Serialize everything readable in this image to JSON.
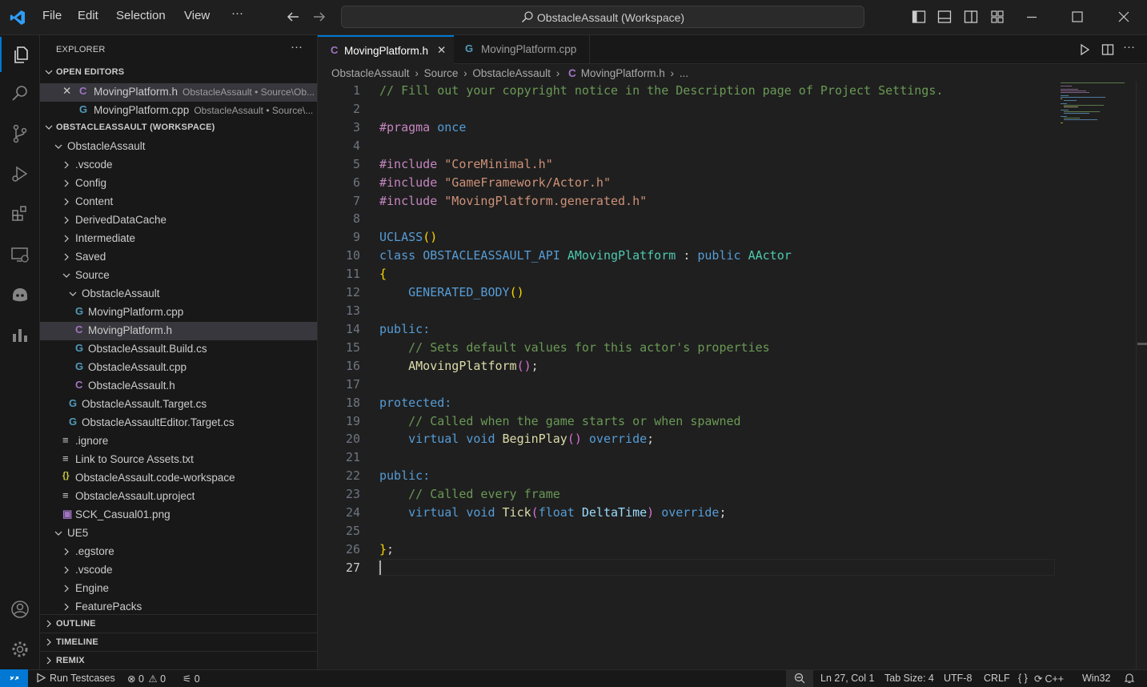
{
  "titlebar": {
    "menu": [
      "File",
      "Edit",
      "Selection",
      "View"
    ],
    "more": "···",
    "command_center": "ObstacleAssault (Workspace)"
  },
  "sidebar": {
    "title": "EXPLORER",
    "more": "···",
    "open_editors": {
      "header": "OPEN EDITORS",
      "items": [
        {
          "name": "MovingPlatform.h",
          "desc": "ObstacleAssault • Source\\Ob..."
        },
        {
          "name": "MovingPlatform.cpp",
          "desc": "ObstacleAssault • Source\\..."
        }
      ]
    },
    "workspace_header": "OBSTACLEASSAULT (WORKSPACE)",
    "tree": [
      "ObstacleAssault",
      ".vscode",
      "Config",
      "Content",
      "DerivedDataCache",
      "Intermediate",
      "Saved",
      "Source",
      "ObstacleAssault",
      "MovingPlatform.cpp",
      "MovingPlatform.h",
      "ObstacleAssault.Build.cs",
      "ObstacleAssault.cpp",
      "ObstacleAssault.h",
      "ObstacleAssault.Target.cs",
      "ObstacleAssaultEditor.Target.cs",
      ".ignore",
      "Link to Source Assets.txt",
      "ObstacleAssault.code-workspace",
      "ObstacleAssault.uproject",
      "SCK_Casual01.png",
      "UE5",
      ".egstore",
      ".vscode",
      "Engine",
      "FeaturePacks"
    ],
    "outline": "OUTLINE",
    "timeline": "TIMELINE",
    "remix": "REMIX"
  },
  "editor": {
    "tabs": [
      "MovingPlatform.h",
      "MovingPlatform.cpp"
    ],
    "breadcrumb": [
      "ObstacleAssault",
      "Source",
      "ObstacleAssault",
      "MovingPlatform.h",
      "..."
    ],
    "line_numbers": [
      "1",
      "2",
      "3",
      "4",
      "5",
      "6",
      "7",
      "8",
      "9",
      "10",
      "11",
      "12",
      "13",
      "14",
      "15",
      "16",
      "17",
      "18",
      "19",
      "20",
      "21",
      "22",
      "23",
      "24",
      "25",
      "26",
      "27"
    ],
    "code": [
      "// Fill out your copyright notice in the Description page of Project Settings.",
      "",
      "#pragma once",
      "",
      "#include \"CoreMinimal.h\"",
      "#include \"GameFramework/Actor.h\"",
      "#include \"MovingPlatform.generated.h\"",
      "",
      "UCLASS()",
      "class OBSTACLEASSAULT_API AMovingPlatform : public AActor",
      "{",
      "    GENERATED_BODY()",
      "",
      "public:",
      "    // Sets default values for this actor's properties",
      "    AMovingPlatform();",
      "",
      "protected:",
      "    // Called when the game starts or when spawned",
      "    virtual void BeginPlay() override;",
      "",
      "public:",
      "    // Called every frame",
      "    virtual void Tick(float DeltaTime) override;",
      "",
      "};",
      ""
    ]
  },
  "statusbar": {
    "run_testcases": "Run Testcases",
    "errors": "0",
    "warnings": "0",
    "ports": "0",
    "position": "Ln 27, Col 1",
    "tab_size": "Tab Size: 4",
    "encoding": "UTF-8",
    "eol": "CRLF",
    "braces": "{ }",
    "language": "C++",
    "platform": "Win32"
  },
  "colors": {
    "accent": "#0078d4",
    "cpp_icon": "#519aba",
    "h_icon": "#a074c4",
    "json_icon": "#cbcb41"
  }
}
